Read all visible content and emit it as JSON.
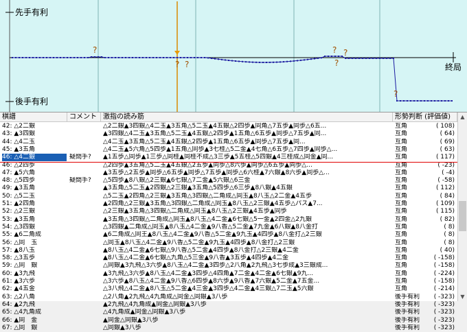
{
  "graph": {
    "sente_label": "先手有利",
    "gote_label": "後手有利",
    "end_label": "終局",
    "question_mark": "?"
  },
  "columns": {
    "move": "棋譜",
    "comment": "コメント",
    "reading": "激指の読み筋",
    "judge": "形勢判断 (評価値)"
  },
  "rows": [
    {
      "move": "42: △2二銀",
      "comment": "",
      "reading": "△2二銀▲3四銀△4二玉▲3五角△5二玉▲4五銀△2四歩▲同角△7五歩▲同歩△6五...",
      "judge": "互角",
      "value": "(    108)"
    },
    {
      "move": "43: ▲3四銀",
      "comment": "",
      "reading": "▲3四銀△4二玉▲3五角△5二玉▲4五銀△2四歩▲1五角△6五歩▲同歩△7五歩▲同...",
      "judge": "互角",
      "value": "(     64)"
    },
    {
      "move": "44: △4二玉",
      "comment": "",
      "reading": "△4二玉▲3五角△5二玉▲4五銀△2四歩▲1五角△6五歩▲同歩△7五歩▲同...",
      "judge": "互角",
      "value": "(     69)"
    },
    {
      "move": "45: ▲3五角",
      "comment": "",
      "reading": "△4二玉▲5六角△5四歩▲1五角△同歩▲3七桂△5二金▲4七角△6五歩△7四歩▲同歩△...",
      "judge": "互角",
      "value": "(     63)"
    },
    {
      "move": "46: △4二銀",
      "comment": "疑問手?",
      "reading": "▲1五歩△同歩▲1三歩△同桂▲同桂不成△3三歩▲5五桂△5四銀▲4三桂成△同金▲同...",
      "judge": "互角",
      "value": "(    117)"
    },
    {
      "move": "46: △2四歩",
      "comment": "",
      "reading": "△2四歩▲3五角△5二玉▲4五銀△2五歩▲同歩△8六歩▲同歩△6五歩▲同歩△...",
      "judge": "互角",
      "value": "(    -23)"
    },
    {
      "move": "47: ▲5六角",
      "comment": "",
      "reading": "▲3五歩△2五歩▲同歩△6五歩▲同歩△7五歩▲同歩△6六桂▲7六銀▲8六歩▲同歩△...",
      "judge": "互角",
      "value": "(     -4)"
    },
    {
      "move": "48: △5四歩",
      "comment": "疑問手?",
      "reading": "△5四歩▲8八銀△2三銀▲6七銀△7二金▲5六銀△6三金",
      "judge": "互角",
      "value": "(    -58)"
    },
    {
      "move": "49: ▲3五角",
      "comment": "",
      "reading": "▲3五角△5二玉▲2四銀△2三銀▲3五角△5四歩△6三歩▲8八銀▲4五銀",
      "judge": "互角",
      "value": "(    112)"
    },
    {
      "move": "50: △5二玉",
      "comment": "",
      "reading": "△5二玉▲2四角△2三銀▲3五角△3四銀△二角成△同玉▲8八玉△2二金▲4五歩",
      "judge": "互角",
      "value": "(     84)"
    },
    {
      "move": "51: ▲2四角",
      "comment": "",
      "reading": "▲2四角△2三銀▲3五角△3四銀△二角成△同玉▲8八玉△2三銀▲4五歩△パス▲7...",
      "judge": "互角",
      "value": "(    109)"
    },
    {
      "move": "52: △2三銀",
      "comment": "",
      "reading": "△2三銀▲3五角△3四銀△二角成△同玉▲8八玉△2三銀▲4五歩▲同歩",
      "judge": "互角",
      "value": "(    115)"
    },
    {
      "move": "53: ▲3五角",
      "comment": "",
      "reading": "▲3五角△3四銀△二角成△同玉▲8八玉△4二金▲6七銀△5一金▲2四金△2九銀",
      "judge": "互角",
      "value": "(     82)"
    },
    {
      "move": "54: △3四銀",
      "comment": "",
      "reading": "△3四銀▲二角成△同玉▲8八玉△4二金▲9八香△5二金▲7九金▲6八銀▲8八金打",
      "judge": "互角",
      "value": "(      8)"
    },
    {
      "move": "55: ▲6二角成",
      "comment": "",
      "reading": "▲6二角成△同王▲8八玉△4二金▲9八香△5二金▲9九玉▲4四歩▲8八金打△2三銀",
      "judge": "互角",
      "value": "(      8)"
    },
    {
      "move": "56: △同　玉",
      "comment": "",
      "reading": "△同玉▲8八玉△4二金▲9八香△5二金▲9九玉▲4四歩▲8八金打△2三銀",
      "judge": "互角",
      "value": "(      8)"
    },
    {
      "move": "57: ▲8八玉",
      "comment": "",
      "reading": "▲8八玉△4二金▲6七銀△9八香△5二金▲4四歩▲8八金打△2三銀▲4二金",
      "judge": "互角",
      "value": "(     40)"
    },
    {
      "move": "58: △3五歩",
      "comment": "",
      "reading": "▲8八玉△4二金▲6七銀△九角△5三金▲9八香▲3五歩▲4四歩▲4二金",
      "judge": "互角",
      "value": "(    -158)"
    },
    {
      "move": "59: △同　銀",
      "comment": "",
      "reading": "△同銀▲3九飛△3六歩▲8八玉△4二金▲3四歩△2八角▲2九飛△3七歩成▲3三銀成...",
      "judge": "互角",
      "value": "(    -158)"
    },
    {
      "move": "60: ▲3九飛",
      "comment": "",
      "reading": "▲3九飛△3六歩▲8八玉△4二金▲3四歩△4四角▲7二金▲4二金▲6七銀▲9九...",
      "judge": "互角",
      "value": "(    -224)"
    },
    {
      "move": "61: ▲3六歩",
      "comment": "",
      "reading": "△3六歩▲8八玉△4二金▲9八香△6四歩▲8六歩▲9八香▲7六銀▲5二金▲7五金...",
      "judge": "互角",
      "value": "(    -158)"
    },
    {
      "move": "62: ▲4五金",
      "comment": "",
      "reading": "△3八飛△4二金▲8八玉△5二金▲4三金▲3四歩△4二金▲4三銀△7二玉▲5六銀",
      "judge": "互角",
      "value": "(    -214)"
    },
    {
      "move": "63: △2八角",
      "comment": "",
      "reading": "△2八角▲2九飛△4九角成△同金△同銀▲3八歩",
      "judge": "後手有利",
      "value": "(    -323)"
    },
    {
      "move": "64: ▲2九飛",
      "comment": "",
      "reading": "▲2九飛△4九角成▲同金△同銀▲3八歩",
      "judge": "後手有利",
      "value": "(    -323)"
    },
    {
      "move": "65: △4九角成",
      "comment": "",
      "reading": "△4九角成▲同金△同銀▲3八歩",
      "judge": "後手有利",
      "value": "(    -323)"
    },
    {
      "move": "66: ▲同　金",
      "comment": "",
      "reading": "▲同金△同銀▲3八歩",
      "judge": "後手有利",
      "value": "(    -323)"
    },
    {
      "move": "67: △同　銀",
      "comment": "",
      "reading": "△同銀▲3八歩",
      "judge": "後手有利",
      "value": "(    -323)"
    }
  ],
  "selected_index": 4,
  "colors": {
    "graph_bg": "#d6f5f5",
    "line": "#1a1aa0",
    "selected": "#1a5fb4",
    "redline": "#e00000"
  }
}
